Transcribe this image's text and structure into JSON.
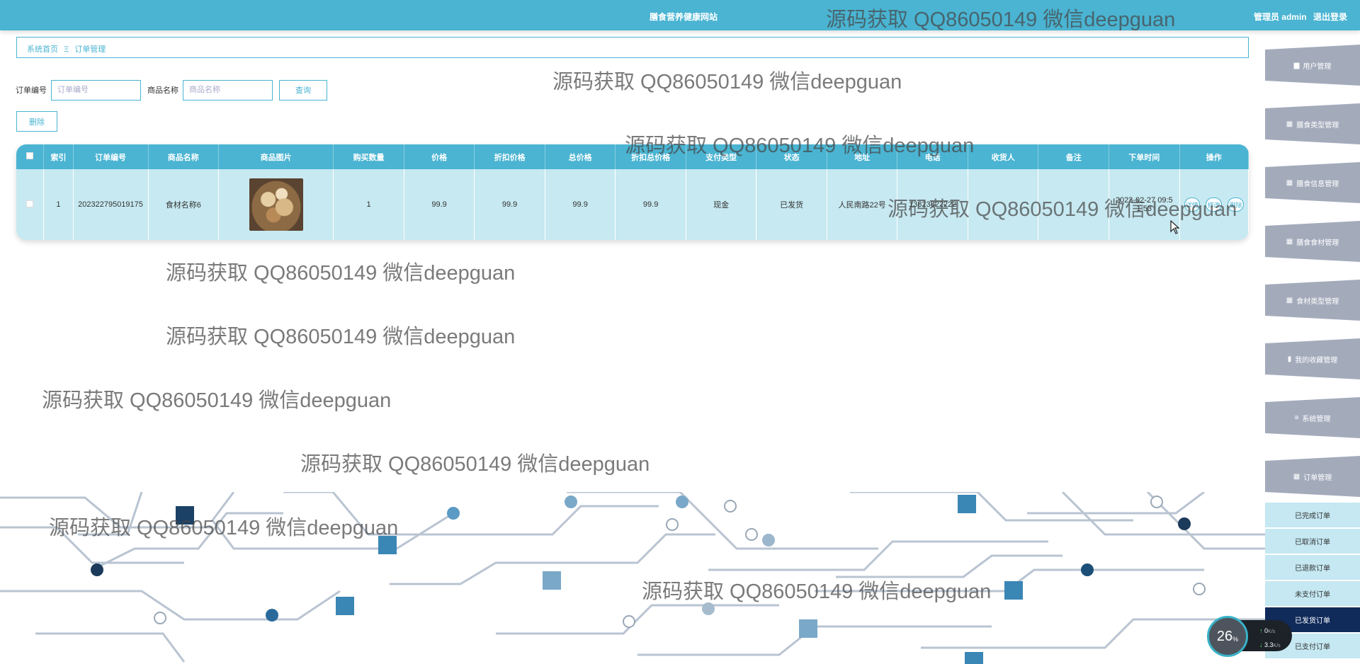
{
  "header": {
    "site_title": "膳食营养健康网站",
    "user_text": "管理员 admin",
    "logout_label": "退出登录"
  },
  "breadcrumb": {
    "home": "系统首页",
    "separator": "Ξ",
    "current": "订单管理"
  },
  "search": {
    "order_no_label": "订单编号",
    "order_no_placeholder": "订单编号",
    "product_name_label": "商品名称",
    "product_name_placeholder": "商品名称",
    "query_label": "查询",
    "delete_label": "删除"
  },
  "table": {
    "headers": [
      "索引",
      "订单编号",
      "商品名称",
      "商品图片",
      "购买数量",
      "价格",
      "折扣价格",
      "总价格",
      "折扣总价格",
      "支付类型",
      "状态",
      "地址",
      "电话",
      "收货人",
      "备注",
      "下单时间",
      "操作"
    ],
    "rows": [
      {
        "index": "1",
        "order_no": "202322795019175",
        "product_name": "食材名称6",
        "quantity": "1",
        "price": "99.9",
        "discount_price": "99.9",
        "total_price": "99.9",
        "discount_total": "99.9",
        "pay_type": "现金",
        "status": "已发货",
        "address": "人民南路22号",
        "phone": "13823822222",
        "receiver": "",
        "remark": "",
        "order_time": "2023-02-27 09:51:53",
        "actions": [
          "详情",
          "修改",
          "删除"
        ]
      }
    ]
  },
  "sidebar": {
    "items": [
      {
        "icon": "user-icon",
        "glyph": "▆",
        "label": "用户管理"
      },
      {
        "icon": "grid-icon",
        "glyph": "▦",
        "label": "膳食类型管理"
      },
      {
        "icon": "grid-icon",
        "glyph": "▦",
        "label": "膳食信息管理"
      },
      {
        "icon": "grid-icon",
        "glyph": "▦",
        "label": "膳食食材管理"
      },
      {
        "icon": "grid-icon",
        "glyph": "▦",
        "label": "食材类型管理"
      },
      {
        "icon": "favorite-icon",
        "glyph": "▮",
        "label": "我的收藏管理"
      },
      {
        "icon": "menu-icon",
        "glyph": "≡",
        "label": "系统管理"
      },
      {
        "icon": "grid-icon",
        "glyph": "▦",
        "label": "订单管理"
      }
    ],
    "sub_items": [
      "已完成订单",
      "已取消订单",
      "已退款订单",
      "未支付订单",
      "已发货订单",
      "已支付订单"
    ],
    "active_sub": "已发货订单"
  },
  "watermark": {
    "text": "源码获取 QQ86050149 微信deepguan"
  },
  "speed_widget": {
    "percent": "26",
    "percent_unit": "%",
    "up": "0",
    "up_unit": "K/s",
    "down": "3.3",
    "down_unit": "K/s"
  },
  "colors": {
    "primary": "#4ab4d2",
    "row_bg": "#c7e9f1",
    "sidebar_bg": "#a3abbb",
    "sub_active": "#102a5a"
  }
}
